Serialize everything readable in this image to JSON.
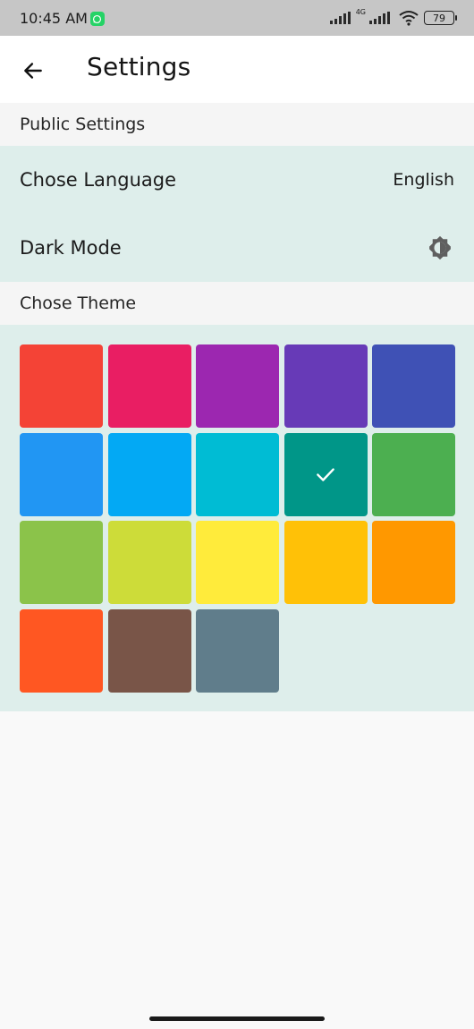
{
  "status_bar": {
    "time": "10:45 AM",
    "network_label": "4G",
    "battery": "79",
    "icons": [
      "whatsapp-icon",
      "signal-icon",
      "signal-4g-icon",
      "wifi-icon",
      "battery-icon"
    ]
  },
  "app_bar": {
    "title": "Settings",
    "back_icon": "arrow-back-icon"
  },
  "public_settings": {
    "header": "Public Settings",
    "language": {
      "label": "Chose Language",
      "value": "English"
    },
    "dark_mode": {
      "label": "Dark Mode",
      "icon": "brightness-icon"
    }
  },
  "theme": {
    "header": "Chose Theme",
    "selected": "#009688",
    "swatches": [
      "#f44336",
      "#e91e63",
      "#9c27b0",
      "#673ab7",
      "#3f51b5",
      "#2196f3",
      "#03a9f4",
      "#00bcd4",
      "#009688",
      "#4caf50",
      "#8bc34a",
      "#cddc39",
      "#ffeb3b",
      "#ffc107",
      "#ff9800",
      "#ff5722",
      "#795548",
      "#607d8b"
    ]
  },
  "colors": {
    "status_bar_bg": "#c6c6c6",
    "app_bar_bg": "#ffffff",
    "section_bg": "#f5f5f5",
    "group_bg": "#deeeeb",
    "page_bg": "#f9f9f9"
  }
}
